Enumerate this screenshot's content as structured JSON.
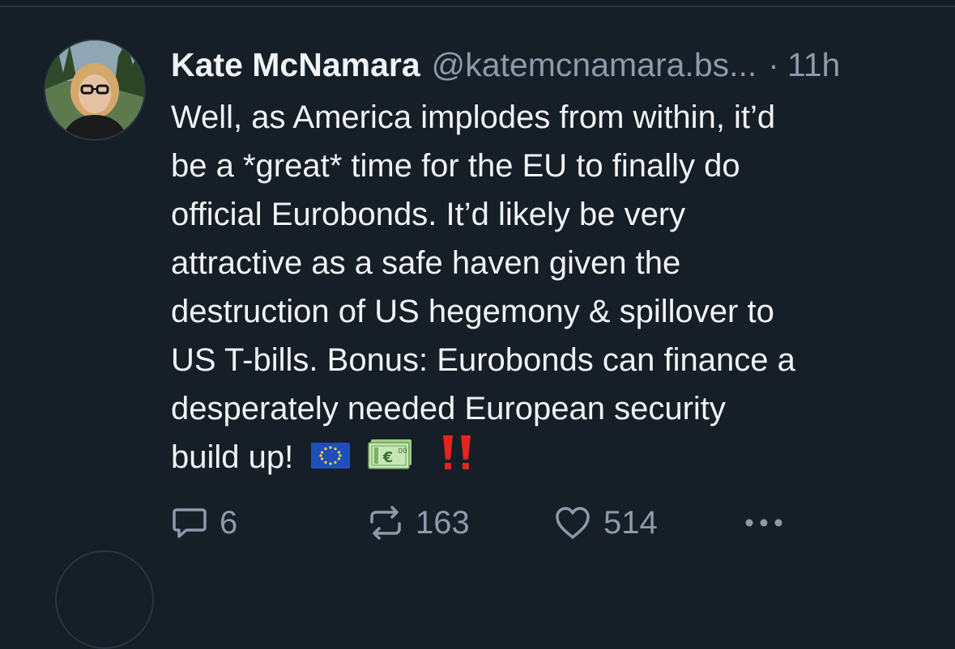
{
  "post": {
    "display_name": "Kate McNamara",
    "handle": "@katemcnamara.bs...",
    "separator": "·",
    "time": "11h",
    "lines": [
      "Well, as America implodes from within, it’d",
      "be a *great* time for the EU to finally do",
      "official Eurobonds. It’d likely be very",
      "attractive as a safe haven given the",
      "destruction of US hegemony & spillover to",
      "US T-bills. Bonus: Eurobonds can finance a",
      "desperately needed European security",
      "build up!"
    ],
    "emojis": [
      "eu-flag-icon",
      "euro-banknote-icon",
      "double-exclamation-icon"
    ],
    "actions": {
      "reply_count": "6",
      "repost_count": "163",
      "like_count": "514"
    }
  },
  "colors": {
    "background": "#161e27",
    "text": "#f1f3f5",
    "muted": "#8c9aab",
    "divider": "#2a3542"
  }
}
